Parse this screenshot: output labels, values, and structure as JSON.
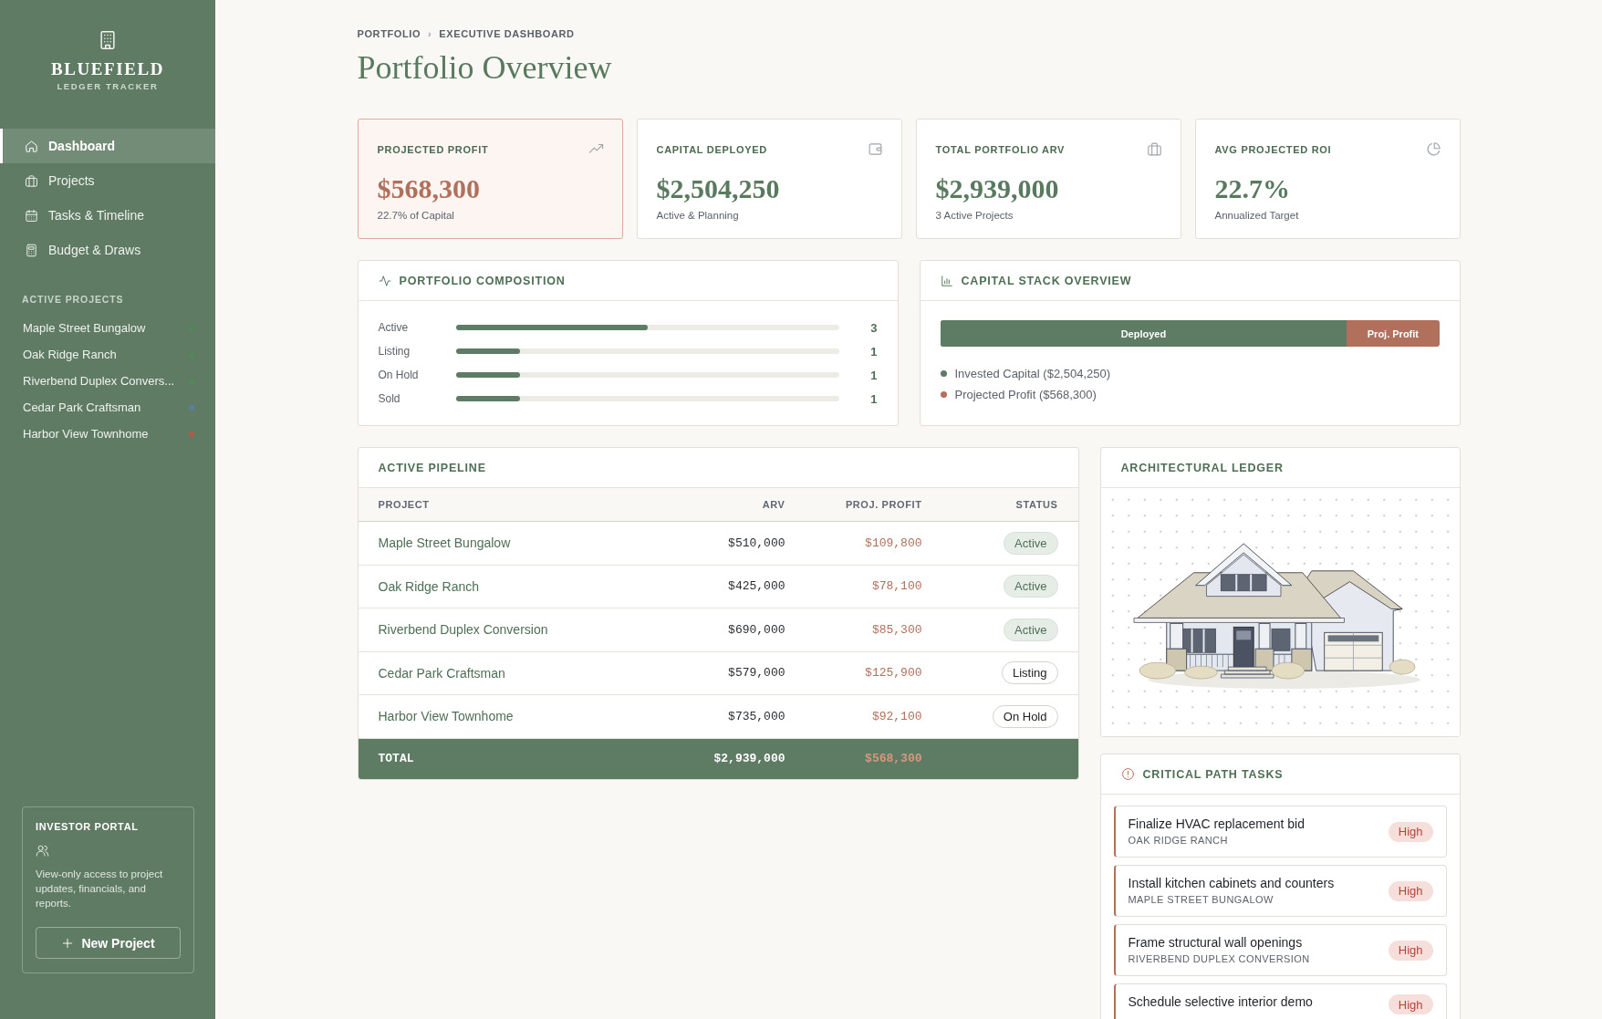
{
  "sidebar": {
    "brand": {
      "name": "BLUEFIELD",
      "tagline": "LEDGER TRACKER"
    },
    "nav": [
      {
        "label": "Dashboard",
        "selected": true
      },
      {
        "label": "Projects",
        "selected": false
      },
      {
        "label": "Tasks & Timeline",
        "selected": false
      },
      {
        "label": "Budget & Draws",
        "selected": false
      }
    ],
    "projects_heading": "ACTIVE PROJECTS",
    "projects": [
      {
        "label": "Maple Street Bungalow",
        "color": "#4f8a5b"
      },
      {
        "label": "Oak Ridge Ranch",
        "color": "#4f8a5b"
      },
      {
        "label": "Riverbend Duplex Convers...",
        "color": "#4f8a5b"
      },
      {
        "label": "Cedar Park Craftsman",
        "color": "#5a7fa6"
      },
      {
        "label": "Harbor View Townhome",
        "color": "#b35a4a"
      }
    ],
    "portal": {
      "title": "INVESTOR PORTAL",
      "text": "View-only access to project updates, financials, and reports.",
      "button": "New Project"
    }
  },
  "breadcrumb": {
    "items": [
      "PORTFOLIO",
      "EXECUTIVE DASHBOARD"
    ],
    "separator": "›"
  },
  "title": "Portfolio Overview",
  "stats": [
    {
      "label": "PROJECTED PROFIT",
      "value": "$568,300",
      "note": "22.7% of Capital",
      "highlighted": true
    },
    {
      "label": "CAPITAL DEPLOYED",
      "value": "$2,504,250",
      "note": "Active & Planning",
      "highlighted": false
    },
    {
      "label": "TOTAL PORTFOLIO ARV",
      "value": "$2,939,000",
      "note": "3 Active Projects",
      "highlighted": false
    },
    {
      "label": "AVG PROJECTED ROI",
      "value": "22.7%",
      "note": "Annualized Target",
      "highlighted": false
    }
  ],
  "composition": {
    "title": "PORTFOLIO COMPOSITION",
    "rows": [
      {
        "label": "Active",
        "level": 0.5,
        "count": "3"
      },
      {
        "label": "Listing",
        "level": 0.167,
        "count": "1"
      },
      {
        "label": "On Hold",
        "level": 0.167,
        "count": "1"
      },
      {
        "label": "Sold",
        "level": 0.167,
        "count": "1"
      }
    ]
  },
  "capital_stack": {
    "title": "CAPITAL STACK OVERVIEW",
    "bar": {
      "level": 0.815,
      "filled_label": "Deployed",
      "remainder_label": "Proj. Profit"
    },
    "legend": [
      {
        "label": "Invested Capital ($2,504,250)",
        "color": "#5e7b64"
      },
      {
        "label": "Projected Profit ($568,300)",
        "color": "#b0705c"
      }
    ]
  },
  "pipeline": {
    "title": "ACTIVE PIPELINE",
    "columns": [
      "PROJECT",
      "ARV",
      "PROJ. PROFIT",
      "STATUS"
    ],
    "rows": [
      {
        "project": "Maple Street Bungalow",
        "arv": "$510,000",
        "profit": "$109,800",
        "status": "Active",
        "kind": "active"
      },
      {
        "project": "Oak Ridge Ranch",
        "arv": "$425,000",
        "profit": "$78,100",
        "status": "Active",
        "kind": "active"
      },
      {
        "project": "Riverbend Duplex Conversion",
        "arv": "$690,000",
        "profit": "$85,300",
        "status": "Active",
        "kind": "active"
      },
      {
        "project": "Cedar Park Craftsman",
        "arv": "$579,000",
        "profit": "$125,900",
        "status": "Listing",
        "kind": "listing"
      },
      {
        "project": "Harbor View Townhome",
        "arv": "$735,000",
        "profit": "$92,100",
        "status": "On Hold",
        "kind": "on_hold"
      }
    ],
    "total": {
      "label": "TOTAL",
      "arv": "$2,939,000",
      "profit": "$568,300"
    }
  },
  "ledger": {
    "title": "ARCHITECTURAL LEDGER"
  },
  "tasks": {
    "title": "CRITICAL PATH TASKS",
    "items": [
      {
        "title": "Finalize HVAC replacement bid",
        "project": "OAK RIDGE RANCH",
        "priority": "High",
        "kind": "high"
      },
      {
        "title": "Install kitchen cabinets and counters",
        "project": "MAPLE STREET BUNGALOW",
        "priority": "High",
        "kind": "high"
      },
      {
        "title": "Frame structural wall openings",
        "project": "RIVERBEND DUPLEX CONVERSION",
        "priority": "High",
        "kind": "high"
      },
      {
        "title": "Schedule selective interior demo",
        "priority": "High",
        "kind": "high"
      }
    ]
  }
}
